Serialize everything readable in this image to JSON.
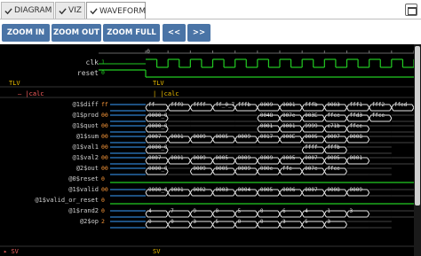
{
  "tabs": [
    {
      "label": "DIAGRAM"
    },
    {
      "label": "VIZ"
    },
    {
      "label": "WAVEFORM"
    }
  ],
  "toolbar": {
    "zoom_in": "ZOOM IN",
    "zoom_out": "ZOOM OUT",
    "zoom_full": "ZOOM FULL",
    "prev": "<<",
    "next": ">>"
  },
  "ruler": {
    "zero": "0"
  },
  "signals": {
    "clk": {
      "name": "clk",
      "value": "1"
    },
    "reset": {
      "name": "reset",
      "value": "0"
    }
  },
  "scopes": {
    "tlv_label": "TLV",
    "calc_label": "|calc",
    "tlv_right": "TLV",
    "calc_right": "|calc"
  },
  "rows": [
    {
      "name": "@1$diff",
      "value": "ff",
      "segs": [
        "ff",
        "fff9",
        "ffff",
        "ff_0_7",
        "fffb",
        "0009",
        "0001",
        "fffb",
        "0003",
        "fff1",
        "fff2",
        "ffed"
      ]
    },
    {
      "name": "@1$prod",
      "value": "00",
      "segs": [
        "0000_0000",
        "",
        "",
        "",
        "",
        "0048",
        "007e",
        "003E",
        "ffce",
        "ffd3",
        "ffce",
        ""
      ]
    },
    {
      "name": "@1$quot",
      "value": "00",
      "segs": [
        "0000_0000",
        "",
        "",
        "",
        "",
        "0001",
        "0001",
        "9999",
        "c71b",
        "ffce",
        "",
        ""
      ]
    },
    {
      "name": "@1$sum",
      "value": "00",
      "segs": [
        "0007",
        "0001",
        "0009",
        "0005",
        "0009",
        "0017",
        "000E",
        "0005",
        "0007",
        "0008",
        "",
        ""
      ]
    },
    {
      "name": "@1$val1",
      "value": "00",
      "segs": [
        "0000_0000",
        "",
        "",
        "",
        "",
        "",
        "",
        "ffff",
        "fffb",
        "",
        ""
      ]
    },
    {
      "name": "@1$val2",
      "value": "00",
      "segs": [
        "0007",
        "0001",
        "0009",
        "0005",
        "0009",
        "0009",
        "0005",
        "0007",
        "0005",
        "0001",
        "",
        ""
      ]
    },
    {
      "name": "@2$out",
      "value": "00",
      "segs": [
        "0000_0000",
        "",
        "0009",
        "0005",
        "0009",
        "000e",
        "ffe",
        "007e",
        "ffce",
        "",
        ""
      ]
    },
    {
      "name": "@0$reset",
      "value": "0",
      "segs": []
    },
    {
      "name": "@1$valid",
      "value": "00",
      "segs": [
        "0000_0000",
        "0001",
        "0002",
        "0003",
        "0004",
        "0005",
        "0006",
        "0007",
        "0008",
        "0009",
        "",
        ""
      ]
    },
    {
      "name": "@1$valid_or_reset",
      "value": "0",
      "segs": []
    },
    {
      "name": "@1$rand2",
      "value": "0",
      "segs": [
        "4",
        "7",
        "9",
        "0",
        "5",
        "0",
        "6",
        "4",
        "1",
        "3",
        "",
        ""
      ]
    },
    {
      "name": "@2$op",
      "value": "2",
      "segs": [
        "0",
        "0",
        "3",
        "5",
        "0",
        "0",
        "3",
        "5",
        "3",
        "",
        ""
      ]
    }
  ],
  "footer": {
    "sv_left": "SV",
    "sv_right": "SV"
  },
  "colors": {
    "tab_active_bg": "#ffffff",
    "button_bg": "#4a74a6",
    "wave_bg": "#000000",
    "signal_green": "#22cc22",
    "signal_blue": "#3aa0ff",
    "value_orange": "#ff9b3a",
    "scope_yellow": "#f0c000"
  }
}
